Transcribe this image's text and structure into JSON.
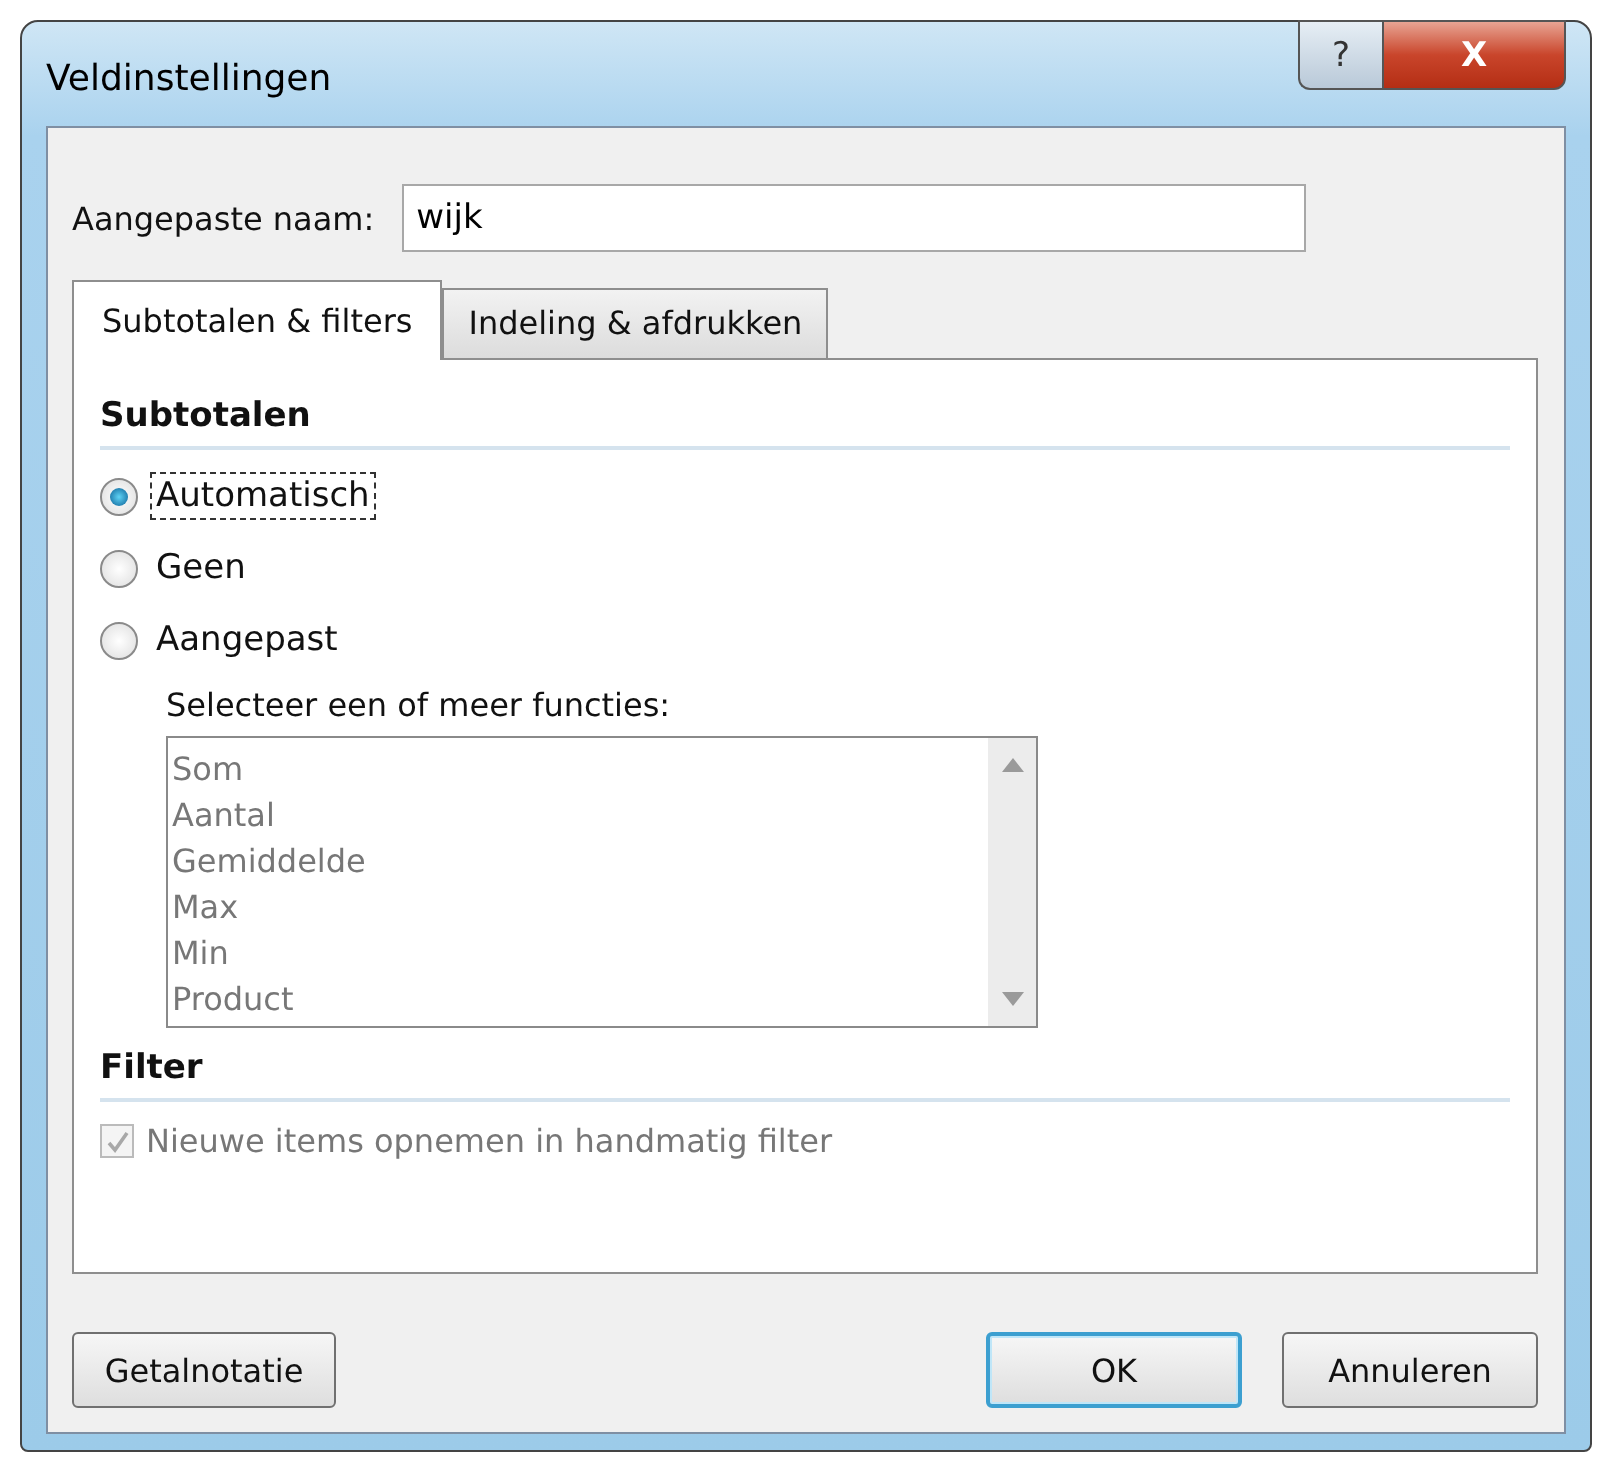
{
  "window": {
    "title": "Veldinstellingen",
    "buttons": [
      {
        "kind": "help",
        "label": "?"
      },
      {
        "kind": "close",
        "label": "X"
      }
    ]
  },
  "name_field": {
    "label": "Aangepaste naam:",
    "value": "wijk"
  },
  "tabs": [
    {
      "label": "Subtotalen & filters",
      "selected": true
    },
    {
      "label": "Indeling & afdrukken",
      "selected": false
    }
  ],
  "subtotals": {
    "heading": "Subtotalen",
    "options": [
      {
        "label": "Automatisch",
        "selected": true,
        "focused": true
      },
      {
        "label": "Geen",
        "selected": false,
        "focused": false
      },
      {
        "label": "Aangepast",
        "selected": false,
        "focused": false
      }
    ],
    "functions_label": "Selecteer een of meer functies:",
    "functions_disabled": true,
    "functions": [
      "Som",
      "Aantal",
      "Gemiddelde",
      "Max",
      "Min",
      "Product"
    ]
  },
  "filter": {
    "heading": "Filter",
    "checkbox": {
      "label": "Nieuwe items opnemen in handmatig filter",
      "checked": true,
      "disabled": true
    }
  },
  "buttons": [
    {
      "label": "Getalnotatie",
      "kind": "left",
      "default": false
    },
    {
      "label": "OK",
      "kind": "right",
      "default": true
    },
    {
      "label": "Annuleren",
      "kind": "right",
      "default": false
    }
  ]
}
